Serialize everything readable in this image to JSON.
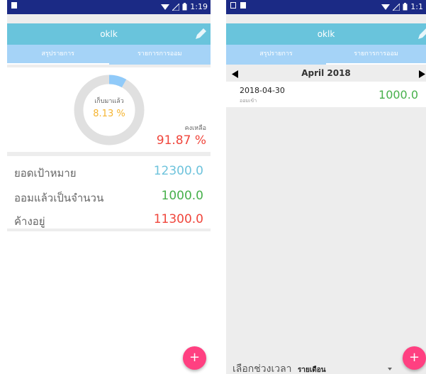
{
  "left": {
    "status_time": "1:19",
    "app_title": "oklk",
    "tabs": [
      "สรุปรายการ",
      "รายการการออม"
    ],
    "donut": {
      "label": "เก็บมาแล้ว",
      "percent": "8.13 %",
      "fraction": 0.0813
    },
    "remaining": {
      "label": "คงเหลือ",
      "percent": "91.87 %"
    },
    "rows": [
      {
        "label": "ยอดเป้าหมาย",
        "value": "12300.0"
      },
      {
        "label": "ออมแล้วเป็นจำนวน",
        "value": "1000.0"
      },
      {
        "label": "ค้างอยู่",
        "value": "11300.0"
      }
    ],
    "fab": "+"
  },
  "right": {
    "status_time": "1:1",
    "app_title": "oklk",
    "tabs": [
      "สรุปรายการ",
      "รายการการออม"
    ],
    "month": "April 2018",
    "entries": [
      {
        "date": "2018-04-30",
        "type": "ออมเข้า",
        "amount": "1000.0"
      }
    ],
    "period_label": "เลือกช่วงเวลา",
    "period_value": "รายเดือน",
    "fab": "+"
  },
  "colors": {
    "status_bar": "#1b2a85",
    "app_bar": "#69c4dc",
    "tab_bar": "#a5d3f7",
    "donut_track": "#e0e0e0",
    "donut_fill": "#90caf9",
    "orange": "#f5b431",
    "red": "#f0463c",
    "blue": "#6ec3dc",
    "green": "#47b04b",
    "fab": "#ff4081"
  }
}
